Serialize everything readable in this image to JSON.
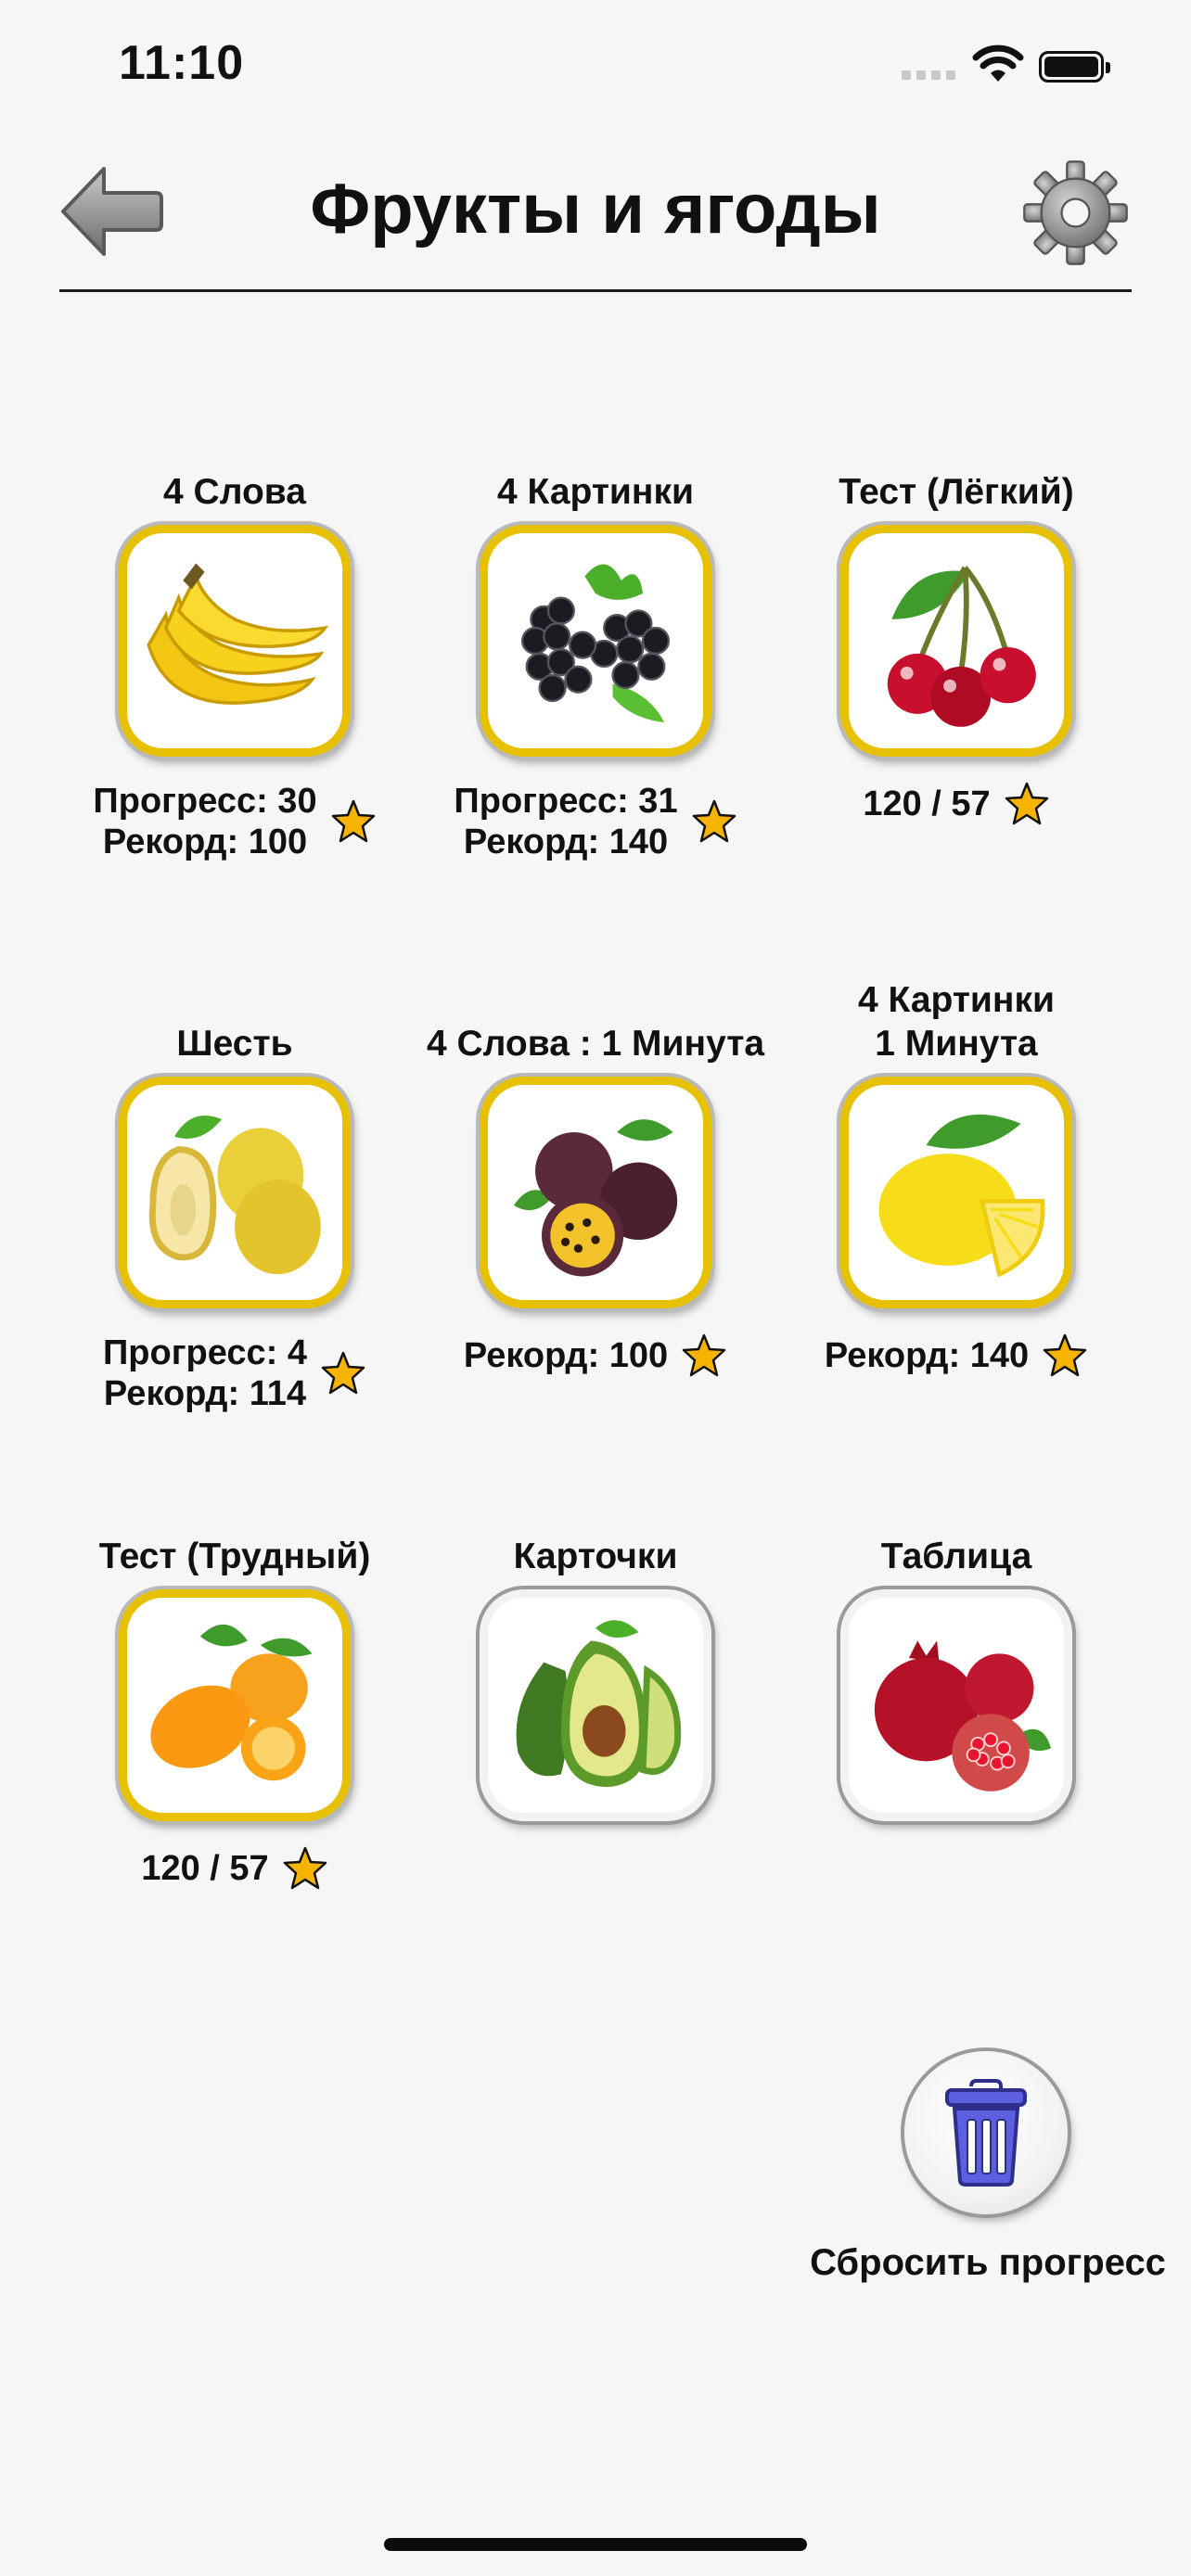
{
  "status_bar": {
    "time": "11:10"
  },
  "header": {
    "title": "Фрукты и ягоды",
    "back_icon": "arrow-left-icon",
    "settings_icon": "gear-icon"
  },
  "tiles": [
    {
      "label": "4 Слова",
      "image": "banana",
      "stats": "Прогресс: 30\nРекорд: 100"
    },
    {
      "label": "4 Картинки",
      "image": "blackberry",
      "stats": "Прогресс: 31\nРекорд: 140"
    },
    {
      "label": "Тест (Лёгкий)",
      "image": "cherry",
      "stats": "120 / 57"
    },
    {
      "label": "Шесть",
      "image": "quince",
      "stats": "Прогресс: 4\nРекорд: 114"
    },
    {
      "label": "4 Слова : 1 Минута",
      "image": "passion-fruit",
      "stats": "Рекорд: 100"
    },
    {
      "label": "4 Картинки\n1 Минута",
      "image": "lemon",
      "stats": "Рекорд: 140"
    },
    {
      "label": "Тест (Трудный)",
      "image": "kumquat",
      "stats": "120 / 57"
    },
    {
      "label": "Карточки",
      "image": "avocado",
      "stats": ""
    },
    {
      "label": "Таблица",
      "image": "pomegranate",
      "stats": ""
    }
  ],
  "reset": {
    "label": "Сбросить прогресс",
    "icon": "trash-icon"
  },
  "colors": {
    "tile_border": "#e7c100",
    "star": "#f6b400",
    "trash": "#5b5fe0",
    "background": "#f6f6f6"
  }
}
